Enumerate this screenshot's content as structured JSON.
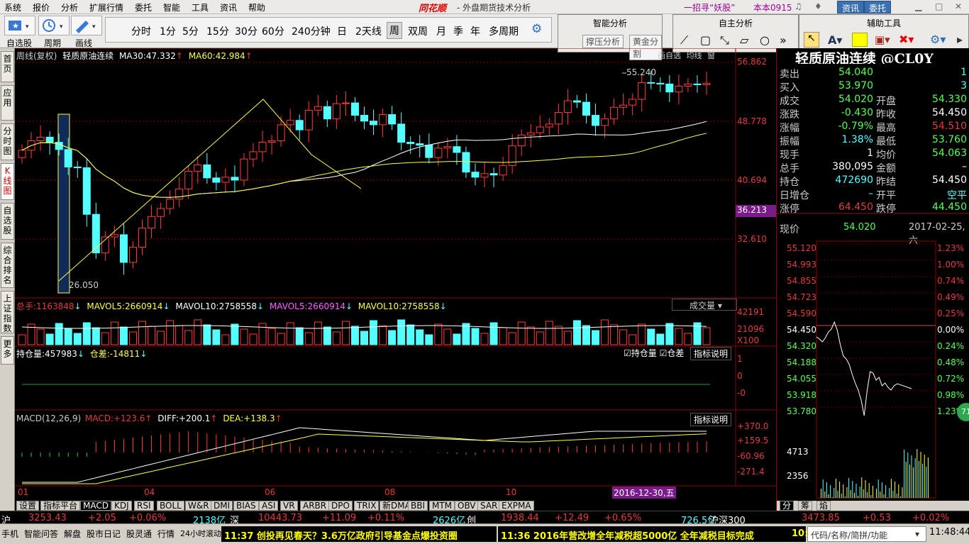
{
  "menu": {
    "items": [
      "系统",
      "报价",
      "分析",
      "扩展行情",
      "委托",
      "智能",
      "工具",
      "资讯",
      "帮助"
    ],
    "brand": "同花顺",
    "title": "- 外盘期货技术分析",
    "promo": "一招寻“妖股”",
    "version": "本本0915",
    "btn_info": "资讯",
    "btn_trade": "委托"
  },
  "toolbar": {
    "watchlist": "自选股",
    "cycle": "周期",
    "draw": "画线",
    "periods": [
      "分时",
      "1分",
      "5分",
      "15分",
      "30分",
      "60分",
      "240分钟",
      "日",
      "2天线",
      "周",
      "双周",
      "月",
      "季",
      "年",
      "多周期"
    ],
    "selected_period": "周",
    "groups": {
      "smart": {
        "title": "智能分析",
        "btns": [
          "撑压分析",
          "黄金分割"
        ]
      },
      "custom": {
        "title": "自主分析"
      },
      "aux": {
        "title": "辅助工具"
      }
    }
  },
  "leftnav": [
    "首页",
    "应用",
    "分时图",
    "K线图",
    "自选股",
    "综合排名",
    "上证指数",
    "更多"
  ],
  "kchart": {
    "header_left": "周线(复权)",
    "name": "轻质原油连续",
    "ma30_label": "MA30:",
    "ma30": "47.332",
    "ma60_label": "MA60:",
    "ma60": "42.984",
    "top_right_btns": [
      "画自选",
      "均线",
      "窗"
    ],
    "yticks": [
      "56.862",
      "48.778",
      "40.694",
      "32.610"
    ],
    "highlight": "36.213",
    "hi_label": "55.240",
    "lo_label": "26.050"
  },
  "vol": {
    "total_label": "总手:",
    "total": "1163848",
    "mavol5_label": "MAVOL5:",
    "mavol5": "2660914",
    "mavol10_label": "MAVOL10:",
    "mavol10": "2758558",
    "mavol5b_label": "MAVOL5:",
    "mavol5b": "2660914",
    "mavol10b_label": "MAVOL10:",
    "mavol10b": "2758558",
    "dropdown": "成交量",
    "yticks": [
      "42191",
      "21096",
      "X100"
    ]
  },
  "oi": {
    "label": "持仓量:",
    "value": "457983",
    "diff_label": "仓差:",
    "diff": "-14811",
    "chk1": "持仓量",
    "chk2": "仓差",
    "help": "指标说明",
    "yticks": [
      "1",
      "0",
      "-0"
    ]
  },
  "macd": {
    "label": "MACD(12,26,9)",
    "macd_label": "MACD:",
    "macd": "+123.6",
    "diff_label": "DIFF:",
    "diff": "+200.1",
    "dea_label": "DEA:",
    "dea": "+138.3",
    "help": "指标说明",
    "yticks": [
      "+370.0",
      "+159.5",
      "-60.96",
      "-271.4"
    ]
  },
  "xaxis": {
    "ticks": [
      "01",
      "04",
      "06",
      "08",
      "10"
    ],
    "cursor_date": "2016-12-30,五"
  },
  "quote": {
    "title": "轻质原油连续 @CL0Y",
    "rows": [
      {
        "l": "卖出",
        "v": "54.040",
        "r": "",
        "rv": "1"
      },
      {
        "l": "买入",
        "v": "53.970",
        "r": "",
        "rv": "3"
      },
      {
        "l": "成交",
        "v": "54.020",
        "r": "开盘",
        "rv": "54.330"
      },
      {
        "l": "涨跌",
        "v": "-0.430",
        "r": "昨收",
        "rv": "54.450"
      },
      {
        "l": "涨幅",
        "v": "-0.79%",
        "r": "最高",
        "rv": "54.510"
      },
      {
        "l": "振幅",
        "v": "1.38%",
        "r": "最低",
        "rv": "53.760"
      },
      {
        "l": "现手",
        "v": "1",
        "r": "均价",
        "rv": "54.063"
      },
      {
        "l": "总手",
        "v": "380,095",
        "r": "金额",
        "rv": "–"
      },
      {
        "l": "持仓",
        "v": "472690",
        "r": "昨结",
        "rv": "54.450"
      },
      {
        "l": "日增仓",
        "v": "–",
        "r": "开平",
        "rv": "空平"
      },
      {
        "l": "涨停",
        "v": "64.450",
        "r": "跌停",
        "rv": "44.450"
      }
    ],
    "now_label": "现价",
    "now": "54.020",
    "now_date": "2017-02-25,六"
  },
  "minichart": {
    "left": [
      "55.120",
      "54.993",
      "54.855",
      "54.723",
      "54.590",
      "54.450",
      "54.320",
      "54.188",
      "54.055",
      "53.918",
      "53.780",
      "4713",
      "2356"
    ],
    "right": [
      "1.23%",
      "1.00%",
      "0.74%",
      "0.49%",
      "0.25%",
      "0.00%",
      "0.24%",
      "0.48%",
      "0.72%",
      "0.98%",
      "1.23%"
    ],
    "badge": "71",
    "tabs": [
      "分",
      "筹",
      "焰"
    ]
  },
  "bottomtabs": [
    "设置",
    "指标平台",
    "MACD",
    "KDJ",
    "RSI",
    "BOLL",
    "W&R",
    "DMI",
    "BIAS",
    "ASI",
    "VR",
    "ARBR",
    "DPO",
    "TRIX",
    "新DMA",
    "BBI",
    "MTM",
    "OBV",
    "SAR",
    "EXPMA"
  ],
  "status": {
    "sh": "沪",
    "sh_idx": "3253.43",
    "sh_chg": "+2.05",
    "sh_pct": "+0.06%",
    "sh_amt": "2138亿",
    "sz": "深",
    "sz_idx": "10443.73",
    "sz_chg": "+11.09",
    "sz_pct": "+0.11%",
    "cy_amt": "2626亿",
    "cy": "创",
    "cy_idx": "1938.44",
    "cy_chg": "+12.49",
    "cy_pct": "+0.65%",
    "hs_amt": "726.5亿",
    "hs": "沪深300",
    "hs_idx": "3473.85",
    "hs_chg": "+0.53",
    "hs_pct": "+0.02%"
  },
  "footer": {
    "items": [
      "手机",
      "智能问答",
      "解盘",
      "股市日记",
      "股灵通",
      "行情",
      "24小时滚动"
    ],
    "news1": "11:37 创投再见春天？3.6万亿政府引导基金点爆投资圈",
    "news2": "11:36 2016年营改增全年减税超5000亿 全年减税目标完成",
    "news3": "10:",
    "search": "代码/名称/简拼/功能",
    "clock": "11:48:44"
  },
  "colors": {
    "up": "#ff3c3c",
    "down": "#54ffff",
    "ma30": "#ffffff",
    "ma60": "#ffff40",
    "axis": "#e03c3c",
    "grid": "#8b0000"
  }
}
